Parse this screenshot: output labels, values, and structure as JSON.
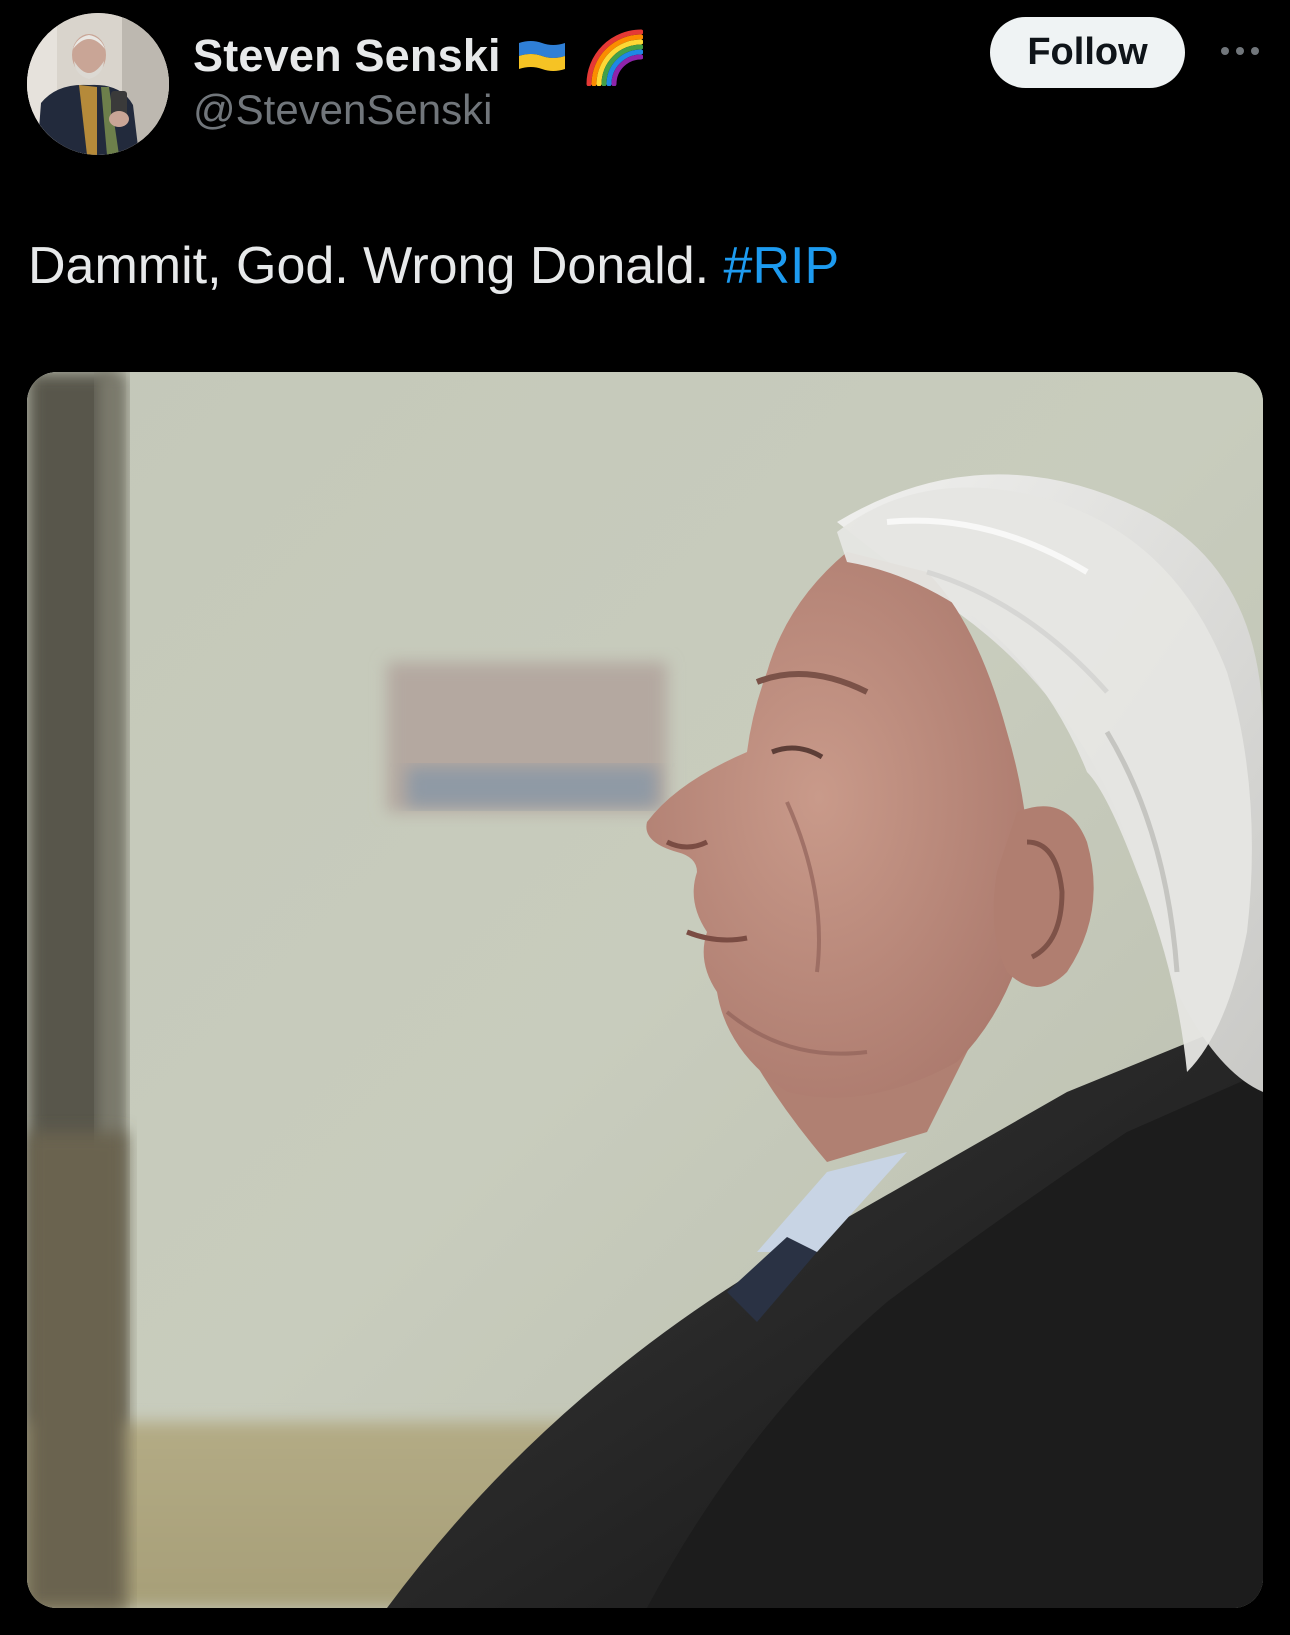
{
  "author": {
    "display_name": "Steven Senski",
    "handle": "@StevenSenski",
    "badges": [
      "ukraine-flag-icon",
      "rainbow-icon"
    ]
  },
  "actions": {
    "follow_label": "Follow",
    "more_icon": "more-icon"
  },
  "tweet": {
    "text": "Dammit, God. Wrong Donald.",
    "hashtag": "#RIP"
  },
  "colors": {
    "background": "#000000",
    "text": "#e7e9ea",
    "secondary_text": "#71767b",
    "link": "#1d9bf0",
    "follow_button_bg": "#eff3f4"
  }
}
